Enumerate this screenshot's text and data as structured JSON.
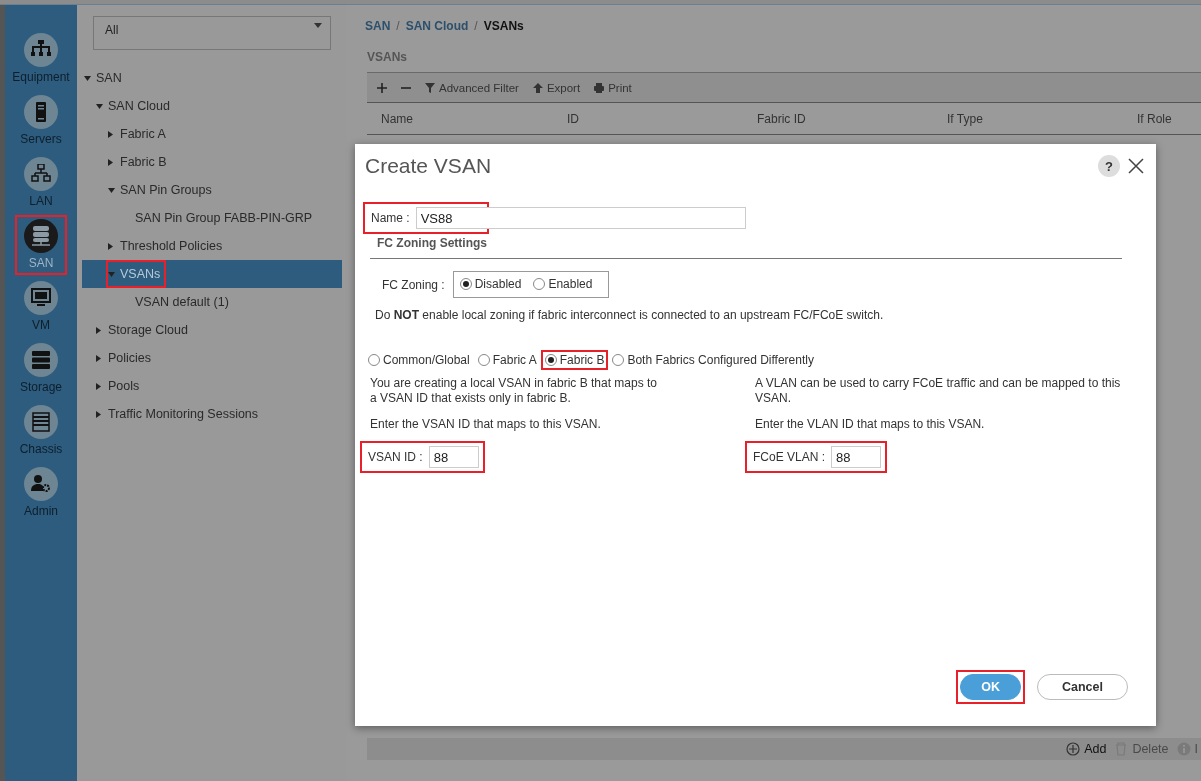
{
  "nav": [
    {
      "kind": "equipment",
      "label": "Equipment",
      "selected": false,
      "highlighted": false
    },
    {
      "kind": "servers",
      "label": "Servers",
      "selected": false,
      "highlighted": false
    },
    {
      "kind": "lan",
      "label": "LAN",
      "selected": false,
      "highlighted": false
    },
    {
      "kind": "san",
      "label": "SAN",
      "selected": true,
      "highlighted": true
    },
    {
      "kind": "vm",
      "label": "VM",
      "selected": false,
      "highlighted": false
    },
    {
      "kind": "storage",
      "label": "Storage",
      "selected": false,
      "highlighted": false
    },
    {
      "kind": "chassis",
      "label": "Chassis",
      "selected": false,
      "highlighted": false
    },
    {
      "kind": "admin",
      "label": "Admin",
      "selected": false,
      "highlighted": false
    }
  ],
  "filter": {
    "value": "All"
  },
  "tree": [
    {
      "label": "SAN",
      "expanded": true,
      "selected": false,
      "highlighted": false,
      "children": [
        {
          "label": "SAN Cloud",
          "expanded": true,
          "selected": false,
          "highlighted": false,
          "children": [
            {
              "label": "Fabric A",
              "expanded": false,
              "selected": false,
              "highlighted": false
            },
            {
              "label": "Fabric B",
              "expanded": false,
              "selected": false,
              "highlighted": false
            },
            {
              "label": "SAN Pin Groups",
              "expanded": true,
              "selected": false,
              "highlighted": false,
              "children": [
                {
                  "label": "SAN Pin Group FABB-PIN-GRP",
                  "selected": false,
                  "highlighted": false
                }
              ]
            },
            {
              "label": "Threshold Policies",
              "expanded": false,
              "selected": false,
              "highlighted": false
            },
            {
              "label": "VSANs",
              "expanded": true,
              "selected": true,
              "highlighted": true,
              "children": [
                {
                  "label": "VSAN default (1)",
                  "selected": false,
                  "highlighted": false
                }
              ]
            }
          ]
        },
        {
          "label": "Storage Cloud",
          "expanded": false,
          "selected": false,
          "highlighted": false
        },
        {
          "label": "Policies",
          "expanded": false,
          "selected": false,
          "highlighted": false
        },
        {
          "label": "Pools",
          "expanded": false,
          "selected": false,
          "highlighted": false
        },
        {
          "label": "Traffic Monitoring Sessions",
          "expanded": false,
          "selected": false,
          "highlighted": false
        }
      ]
    }
  ],
  "breadcrumb": {
    "items": [
      "SAN",
      "SAN Cloud",
      "VSANs"
    ],
    "separator": "/"
  },
  "section_title": "VSANs",
  "toolbar": [
    {
      "kind": "plus"
    },
    {
      "kind": "minus"
    },
    {
      "kind": "filter",
      "label": "Advanced Filter"
    },
    {
      "kind": "export",
      "label": "Export"
    },
    {
      "kind": "print",
      "label": "Print"
    }
  ],
  "columns": [
    "Name",
    "ID",
    "Fabric ID",
    "If Type",
    "If Role"
  ],
  "bottom_actions": [
    {
      "kind": "add",
      "label": "Add",
      "disabled": false
    },
    {
      "kind": "delete",
      "label": "Delete",
      "disabled": true
    },
    {
      "kind": "info",
      "label": "I",
      "disabled": true
    }
  ],
  "dialog": {
    "title": "Create VSAN",
    "help": "?",
    "name_field": {
      "label": "Name :",
      "value": "VS88",
      "highlighted": true
    },
    "zoning_title": "FC Zoning Settings",
    "zoning": {
      "label": "FC Zoning :",
      "options": [
        {
          "label": "Disabled",
          "selected": true
        },
        {
          "label": "Enabled",
          "selected": false
        }
      ]
    },
    "warning": "Do **NOT** enable local zoning if fabric interconnect is connected to an upstream FC/FCoE switch.",
    "scope_options": [
      {
        "label": "Common/Global",
        "selected": false,
        "highlighted": false
      },
      {
        "label": "Fabric A",
        "selected": false,
        "highlighted": false
      },
      {
        "label": "Fabric B",
        "selected": true,
        "highlighted": true
      },
      {
        "label": "Both Fabrics Configured Differently",
        "selected": false,
        "highlighted": false
      }
    ],
    "left_text": "You are creating a local VSAN in fabric B that maps to a VSAN ID that exists only in fabric B.",
    "left_prompt": "Enter the VSAN ID that maps to this VSAN.",
    "vsan_id": {
      "label": "VSAN ID :",
      "value": "88",
      "highlighted": true
    },
    "right_text": "A VLAN can be used to carry FCoE traffic and can be mapped to this VSAN.",
    "right_prompt": "Enter the VLAN ID that maps to this VSAN.",
    "fcoe_vlan": {
      "label": "FCoE VLAN :",
      "value": "88",
      "highlighted": true
    },
    "buttons": [
      {
        "kind": "primary",
        "label": "OK",
        "highlighted": true
      },
      {
        "kind": "secondary",
        "label": "Cancel",
        "highlighted": false
      }
    ]
  }
}
